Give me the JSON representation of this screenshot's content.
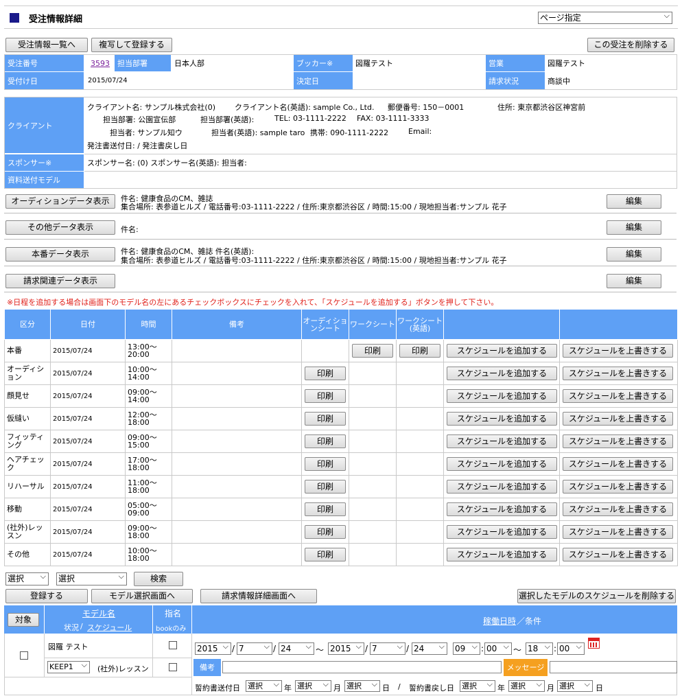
{
  "page": {
    "title": "受注情報詳細",
    "page_select": "ページ指定"
  },
  "toolbar": {
    "list_btn": "受注情報一覧へ",
    "copy_btn": "複写して登録する",
    "delete_btn": "この受注を削除する"
  },
  "summary": {
    "order_no_label": "受注番号",
    "order_no": "3593",
    "dept_label": "担当部署",
    "dept": "日本人部",
    "booker_label": "ブッカー※",
    "booker": "図羅テスト",
    "sales_label": "営業",
    "sales": "図羅テスト",
    "received_label": "受付け日",
    "received": "2015/07/24",
    "decided_label": "決定日",
    "decided": "",
    "billing_label": "請求状況",
    "billing": "商談中"
  },
  "client": {
    "label": "クライアント",
    "line1a": "クライアント名: サンプル株式会社(0)",
    "line1b": "クライアント名(英語): sample Co., Ltd.",
    "line1c": "郵便番号: 150－0001",
    "line1d": "住所: 東京都渋谷区神宮前",
    "line2a": "担当部署: 公園宣伝部",
    "line2b": "担当部署(英語):",
    "line2c": "TEL: 03-1111-2222",
    "line2d": "FAX: 03-1111-3333",
    "line3a": "担当者: サンプル知ウ",
    "line3b": "担当者(英語): sample taro",
    "line3c": "携帯: 090-1111-2222",
    "line3d": "Email:",
    "line4": "発注書送付日:  /  発注書戻し日",
    "sponsor_label": "スポンサー※",
    "sponsor": "スポンサー名: (0)   スポンサー名(英語):   担当者:",
    "model_label": "資料送付モデル"
  },
  "sections": {
    "audition_btn": "オーディションデータ表示",
    "audition_l1": "件名: 健康食品のCM、雑誌",
    "audition_l2": "集合場所:  表参道ヒルズ  /  電話番号:03-1111-2222  /  住所:東京都渋谷区  /  時間:15:00  /  現地担当者:サンプル  花子",
    "other_btn": "その他データ表示",
    "other_l1": "件名:",
    "honban_btn": "本番データ表示",
    "honban_l1": "件名: 健康食品のCM、雑誌  件名(英語):",
    "honban_l2": "集合場所:  表参道ヒルズ  /  電話番号:03-1111-2222  /  住所:東京都渋谷区  /  時間:15:00  /  現地担当者:サンプル  花子",
    "billing_btn": "請求関連データ表示",
    "edit": "編集"
  },
  "notice": "※日程を追加する場合は画面下のモデル名の左にあるチェックボックスにチェックを入れて、「スケジュールを追加する」ボタンを押して下さい。",
  "schedule": {
    "headers": {
      "kubun": "区分",
      "date": "日付",
      "time": "時間",
      "note": "備考",
      "aud_sheet": "オーディションシート",
      "work_sheet": "ワークシート",
      "work_sheet_en": "ワークシート(英語)"
    },
    "print": "印刷",
    "add": "スケジュールを追加する",
    "overwrite": "スケジュールを上書きする",
    "rows": [
      {
        "kubun": "本番",
        "date": "2015/07/24",
        "t1": "13:00～",
        "t2": "20:00"
      },
      {
        "kubun": "オーディション",
        "date": "2015/07/24",
        "t1": "10:00～",
        "t2": "14:00"
      },
      {
        "kubun": "顔見せ",
        "date": "2015/07/24",
        "t1": "09:00～",
        "t2": "14:00"
      },
      {
        "kubun": "仮縫い",
        "date": "2015/07/24",
        "t1": "12:00～",
        "t2": "18:00"
      },
      {
        "kubun": "フィッティング",
        "date": "2015/07/24",
        "t1": "09:00～",
        "t2": "15:00"
      },
      {
        "kubun": "ヘアチェック",
        "date": "2015/07/24",
        "t1": "17:00～",
        "t2": "18:00"
      },
      {
        "kubun": "リハーサル",
        "date": "2015/07/24",
        "t1": "11:00～",
        "t2": "18:00"
      },
      {
        "kubun": "移動",
        "date": "2015/07/24",
        "t1": "05:00～",
        "t2": "09:00"
      },
      {
        "kubun": "(社外)レッスン",
        "date": "2015/07/24",
        "t1": "09:00～",
        "t2": "18:00"
      },
      {
        "kubun": "その他",
        "date": "2015/07/24",
        "t1": "10:00～",
        "t2": "18:00"
      }
    ]
  },
  "filter": {
    "sel1": "選択",
    "sel2": "選択",
    "search": "検索"
  },
  "actions": {
    "register": "登録する",
    "model_select": "モデル選択画面へ",
    "billing_detail": "請求情報詳細画面へ",
    "delete_sched": "選択したモデルのスケジュールを削除する"
  },
  "models": {
    "target": "対象",
    "model_name": "モデル名",
    "status": "状況",
    "schedule": "スケジュール",
    "shimei": "指名",
    "book_only": "bookのみ",
    "working": "稼働日時",
    "condition": "／条件",
    "name": "図羅  テスト",
    "status_val": "KEEP1",
    "lesson": "(社外)レッスン",
    "y1": "2015",
    "m1": "7",
    "d1": "24",
    "tilde": "～",
    "y2": "2015",
    "m2": "7",
    "d2": "24",
    "h1": "09",
    "mi1": "00",
    "h2": "18",
    "mi2": "00",
    "note_label": "備考",
    "message_label": "メッセージ",
    "contract_send": "誓約書送付日",
    "contract_ret": "誓約書戻し日",
    "sel": "選択",
    "year": "年",
    "month": "月",
    "day": "日",
    "slash": "/"
  }
}
